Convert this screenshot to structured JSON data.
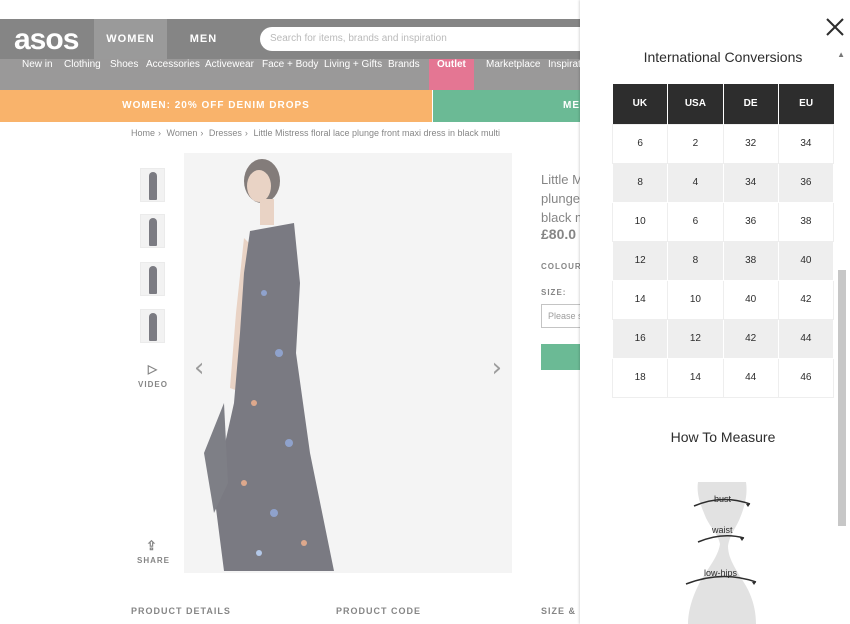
{
  "header": {
    "logo": "asos",
    "gender_tabs": [
      "WOMEN",
      "MEN"
    ],
    "search_placeholder": "Search for items, brands and inspiration"
  },
  "nav": {
    "items": [
      "New in",
      "Clothing",
      "Shoes",
      "Accessories",
      "Activewear",
      "Face + Body",
      "Living + Gifts",
      "Brands",
      "Outlet",
      "Marketplace",
      "Inspiration"
    ]
  },
  "promo": {
    "left": "WOMEN: 20% OFF DENIM DROPS",
    "right": "MEN"
  },
  "breadcrumb": [
    "Home",
    "Women",
    "Dresses",
    "Little Mistress floral lace plunge front maxi dress in black multi"
  ],
  "gallery": {
    "video_label": "VIDEO",
    "share_label": "SHARE"
  },
  "product": {
    "title_lines": [
      "Little M",
      "plunge",
      "black m"
    ],
    "price": "£80.0",
    "colour_label": "COLOUR:",
    "size_label": "SIZE:",
    "size_select": "Please s"
  },
  "details_headers": [
    "PRODUCT DETAILS",
    "PRODUCT CODE",
    "SIZE & F"
  ],
  "drawer": {
    "conversions_title": "International Conversions",
    "columns": [
      "UK",
      "USA",
      "DE",
      "EU"
    ],
    "rows": [
      [
        "6",
        "2",
        "32",
        "34"
      ],
      [
        "8",
        "4",
        "34",
        "36"
      ],
      [
        "10",
        "6",
        "36",
        "38"
      ],
      [
        "12",
        "8",
        "38",
        "40"
      ],
      [
        "14",
        "10",
        "40",
        "42"
      ],
      [
        "16",
        "12",
        "42",
        "44"
      ],
      [
        "18",
        "14",
        "44",
        "46"
      ]
    ],
    "measure_title": "How To Measure",
    "measure_labels": [
      "bust",
      "waist",
      "low-hips"
    ]
  },
  "colors": {
    "topbar": "#2d2d2d",
    "navbar": "#525050",
    "outlet": "#d01345",
    "promo_orange": "#f57d00",
    "promo_green": "#018849",
    "table_header": "#2d2d2d",
    "row_shade": "#eeeeee"
  }
}
